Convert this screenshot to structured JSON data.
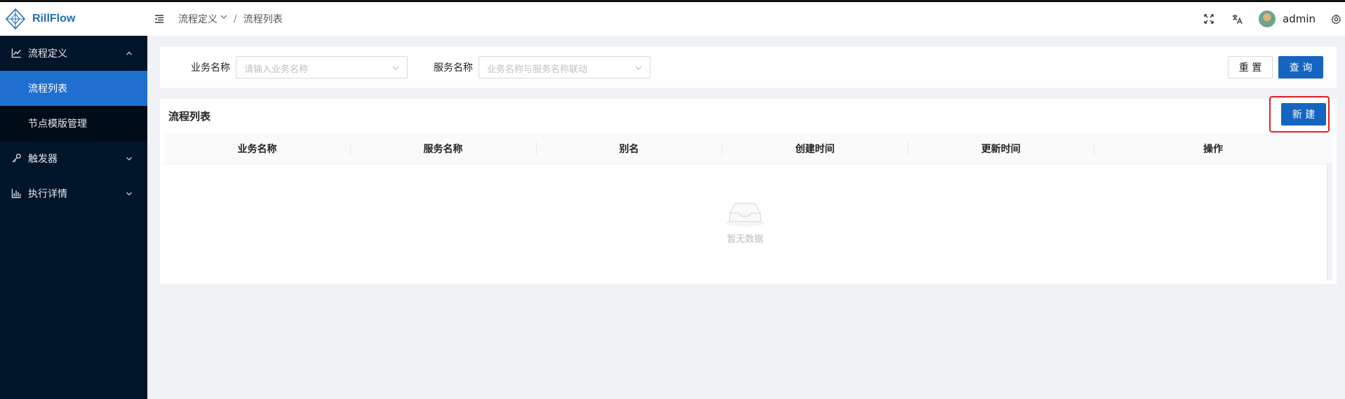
{
  "app": {
    "name": "RillFlow"
  },
  "header": {
    "breadcrumb": [
      "流程定义",
      "流程列表"
    ],
    "breadcrumb_sep": "/",
    "user": "admin",
    "icons": [
      "menu-fold-icon",
      "fullscreen-icon",
      "translate-icon",
      "avatar",
      "gear-icon"
    ]
  },
  "sidebar": {
    "groups": [
      {
        "label": "流程定义",
        "icon": "line-chart-icon",
        "expanded": true,
        "children": [
          {
            "label": "流程列表",
            "active": true
          },
          {
            "label": "节点模版管理",
            "active": false
          }
        ]
      },
      {
        "label": "触发器",
        "icon": "key-icon",
        "expanded": false
      },
      {
        "label": "执行详情",
        "icon": "bar-chart-icon",
        "expanded": false
      }
    ]
  },
  "filters": {
    "business_label": "业务名称",
    "business_placeholder": "请输入业务名称",
    "service_label": "服务名称",
    "service_placeholder": "业务名称与服务名称联动",
    "reset_label": "重 置",
    "search_label": "查 询"
  },
  "table": {
    "title": "流程列表",
    "new_label": "新 建",
    "columns": [
      "业务名称",
      "服务名称",
      "别名",
      "创建时间",
      "更新时间",
      "操作"
    ],
    "rows": [],
    "empty_text": "暂无数据"
  },
  "colors": {
    "sidebar_bg": "#001529",
    "primary": "#1565c0",
    "active_menu": "#1f6fd0",
    "highlight": "#e02020"
  }
}
